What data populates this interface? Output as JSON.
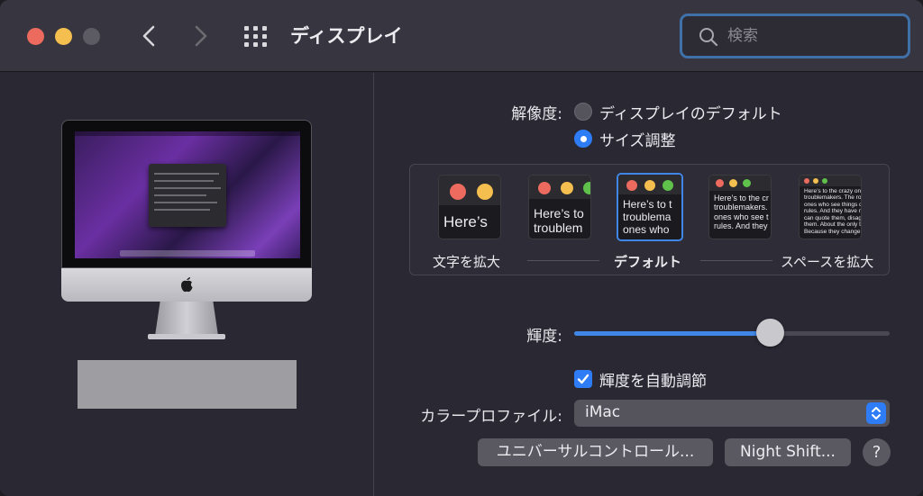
{
  "window": {
    "title": "ディスプレイ"
  },
  "search": {
    "placeholder": "検索",
    "value": ""
  },
  "resolution": {
    "label": "解像度:",
    "options": [
      {
        "label": "ディスプレイのデフォルト",
        "selected": false
      },
      {
        "label": "サイズ調整",
        "selected": true
      }
    ]
  },
  "scaling": {
    "thumbnails": [
      {
        "text": "Here’s",
        "selected": false
      },
      {
        "text": "Here’s to\ntroublem",
        "selected": false
      },
      {
        "text": "Here’s to t\ntroublema\nones who",
        "selected": true
      },
      {
        "text": "Here’s to the cr\ntroublemakers.\nones who see t\nrules. And they",
        "selected": false
      },
      {
        "text": "Here’s to the crazy one\ntroublemakers. The rou\nones who see things dif\nrules. And they have no\ncan quote them, disagre\nthem. About the only th\nBecause they change th",
        "selected": false
      }
    ],
    "label_left": "文字を拡大",
    "label_center": "デフォルト",
    "label_right": "スペースを拡大"
  },
  "brightness": {
    "label": "輝度:",
    "level": 0.62
  },
  "auto_brightness": {
    "label": "輝度を自動調節",
    "checked": true
  },
  "color_profile": {
    "label": "カラープロファイル:",
    "value": "iMac"
  },
  "buttons": {
    "universal_control": "ユニバーサルコントロール...",
    "night_shift": "Night Shift...",
    "help": "?"
  },
  "colors": {
    "accent": "#2f7df6",
    "close": "#ec6a5e",
    "minimize": "#f4bf4f",
    "zoom_disabled": "#5c5a63"
  }
}
